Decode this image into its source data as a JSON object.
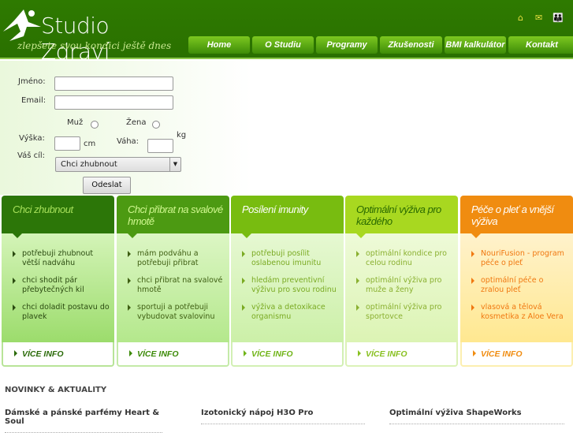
{
  "header": {
    "brand": "Studio Zdraví",
    "slogan": "zlepšete svou kondici ještě dnes",
    "icons": [
      "home-icon",
      "mail-icon",
      "people-icon"
    ]
  },
  "nav": [
    "Home",
    "O Studiu",
    "Programy",
    "Zkušenosti",
    "BMI kalkulátor",
    "Kontakt"
  ],
  "form": {
    "name_label": "Jméno:",
    "email_label": "Email:",
    "male": "Muž",
    "female": "Žena",
    "height_label": "Výška:",
    "height_unit": "cm",
    "weight_label": "Váha:",
    "weight_unit": "kg",
    "goal_label": "Váš cíl:",
    "goal_value": "Chci zhubnout",
    "submit": "Odeslat"
  },
  "columns": [
    {
      "title": "Chci zhubnout",
      "items": [
        "potřebuji zhubnout větší nadváhu",
        "chci shodit pár přebytečných kil",
        "chci doladit postavu do plavek"
      ],
      "more": "VÍCE INFO",
      "head": "#2c7608",
      "title_color": "#a6e05a",
      "body": "linear-gradient(#d4f4b8,#9cdc6c)",
      "text": "#2a4a10",
      "more_color": "#2a6a08",
      "border": "#b8e498"
    },
    {
      "title": "Chci přibrat na svalové hmotě",
      "items": [
        "mám podváhu a potřebuji přibrat",
        "chci přibrat na svalové hmotě",
        "sportuji a potřebuji vybudovat svalovinu"
      ],
      "more": "VÍCE INFO",
      "head": "#4c9a12",
      "title_color": "#d0f890",
      "body": "linear-gradient(#dcf6c4,#b4e88c)",
      "text": "#3e5e12",
      "more_color": "#3c8a08",
      "border": "#c4eaa8"
    },
    {
      "title": "Posílení imunity",
      "items": [
        "potřebuji posílit oslabenou imunitu",
        "hledám preventivní výživu pro svou rodinu",
        "výživa a detoxikace organismu"
      ],
      "more": "VÍCE INFO",
      "head": "#78bc10",
      "title_color": "#ffffff",
      "body": "linear-gradient(#e6f8d2,#ccf0a8)",
      "text": "#7aaa22",
      "more_color": "#70b418",
      "border": "#d2f0b4"
    },
    {
      "title": "Optimální výživa pro každého",
      "items": [
        "optimální kondice pro celou rodinu",
        "optimální výživa pro muže a ženy",
        "optimální výživa pro sportovce"
      ],
      "more": "VÍCE INFO",
      "head": "#a8d820",
      "title_color": "#2a6a00",
      "body": "linear-gradient(#eefad8,#dcf4b4)",
      "text": "#8ab030",
      "more_color": "#88c020",
      "border": "#dcf2b8"
    },
    {
      "title": "Péče o pleť a vnější výživa",
      "items": [
        "NouriFusion - program péče o pleť",
        "optimální péče o zralou pleť",
        "vlasová a tělová kosmetika z Aloe Vera"
      ],
      "more": "VÍCE INFO",
      "head": "#f08c10",
      "title_color": "#ffffff",
      "body": "linear-gradient(#fff2cc,#ffe890)",
      "text": "#f07810",
      "more_color": "#f08c10",
      "border": "#fcefb0"
    }
  ],
  "news": {
    "title": "NOVINKY & AKTUALITY",
    "items": [
      "Dámské a pánské parfémy Heart & Soul",
      "Izotonický nápoj H3O Pro",
      "Optimální výživa ShapeWorks"
    ]
  }
}
